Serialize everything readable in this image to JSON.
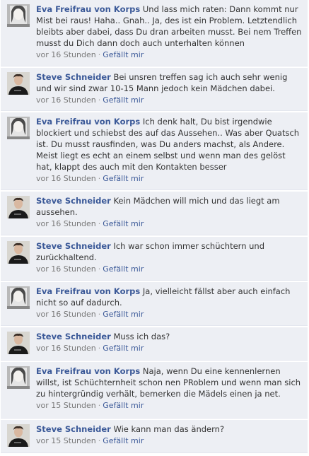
{
  "comments": [
    {
      "author": "Eva Freifrau von Korps",
      "avatar": "eva",
      "text": "Und lass mich raten: Dann kommt nur Mist bei raus! Haha.. Gnah.. Ja, des ist ein Problem. Letztendlich bleibts aber dabei, dass Du dran arbeiten musst. Bei nem Treffen musst du Dich dann doch auch unterhalten können",
      "time": "vor 16 Stunden",
      "like": "Gefällt mir"
    },
    {
      "author": "Steve Schneider",
      "avatar": "steve",
      "text": "Bei unsren treffen sag ich auch sehr wenig und wir sind zwar 10-15 Mann jedoch kein Mädchen dabei.",
      "time": "vor 16 Stunden",
      "like": "Gefällt mir"
    },
    {
      "author": "Eva Freifrau von Korps",
      "avatar": "eva",
      "text": "Ich denk halt, Du bist irgendwie blockiert und schiebst des auf das Aussehen.. Was aber Quatsch ist. Du musst rausfinden, was Du anders machst, als Andere. Meist liegt es echt an einem selbst und wenn man des gelöst hat, klappt des auch mit den Kontakten besser",
      "time": "vor 16 Stunden",
      "like": "Gefällt mir"
    },
    {
      "author": "Steve Schneider",
      "avatar": "steve",
      "text": "Kein Mädchen will mich und das liegt am aussehen.",
      "time": "vor 16 Stunden",
      "like": "Gefällt mir"
    },
    {
      "author": "Steve Schneider",
      "avatar": "steve",
      "text": "Ich war schon immer schüchtern und zurückhaltend.",
      "time": "vor 16 Stunden",
      "like": "Gefällt mir"
    },
    {
      "author": "Eva Freifrau von Korps",
      "avatar": "eva",
      "text": "Ja, vielleicht fällst aber auch einfach nicht so auf dadurch.",
      "time": "vor 16 Stunden",
      "like": "Gefällt mir"
    },
    {
      "author": "Steve Schneider",
      "avatar": "steve",
      "text": "Muss ich das?",
      "time": "vor 16 Stunden",
      "like": "Gefällt mir"
    },
    {
      "author": "Eva Freifrau von Korps",
      "avatar": "eva",
      "text": "Naja, wenn Du eine kennenlernen willst, ist Schüchternheit schon nen PRoblem und wenn man sich zu hintergründig verhält, bemerken die Mädels einen ja net.",
      "time": "vor 15 Stunden",
      "like": "Gefällt mir"
    },
    {
      "author": "Steve Schneider",
      "avatar": "steve",
      "text": "Wie kann man das ändern?",
      "time": "vor 15 Stunden",
      "like": "Gefällt mir"
    }
  ]
}
